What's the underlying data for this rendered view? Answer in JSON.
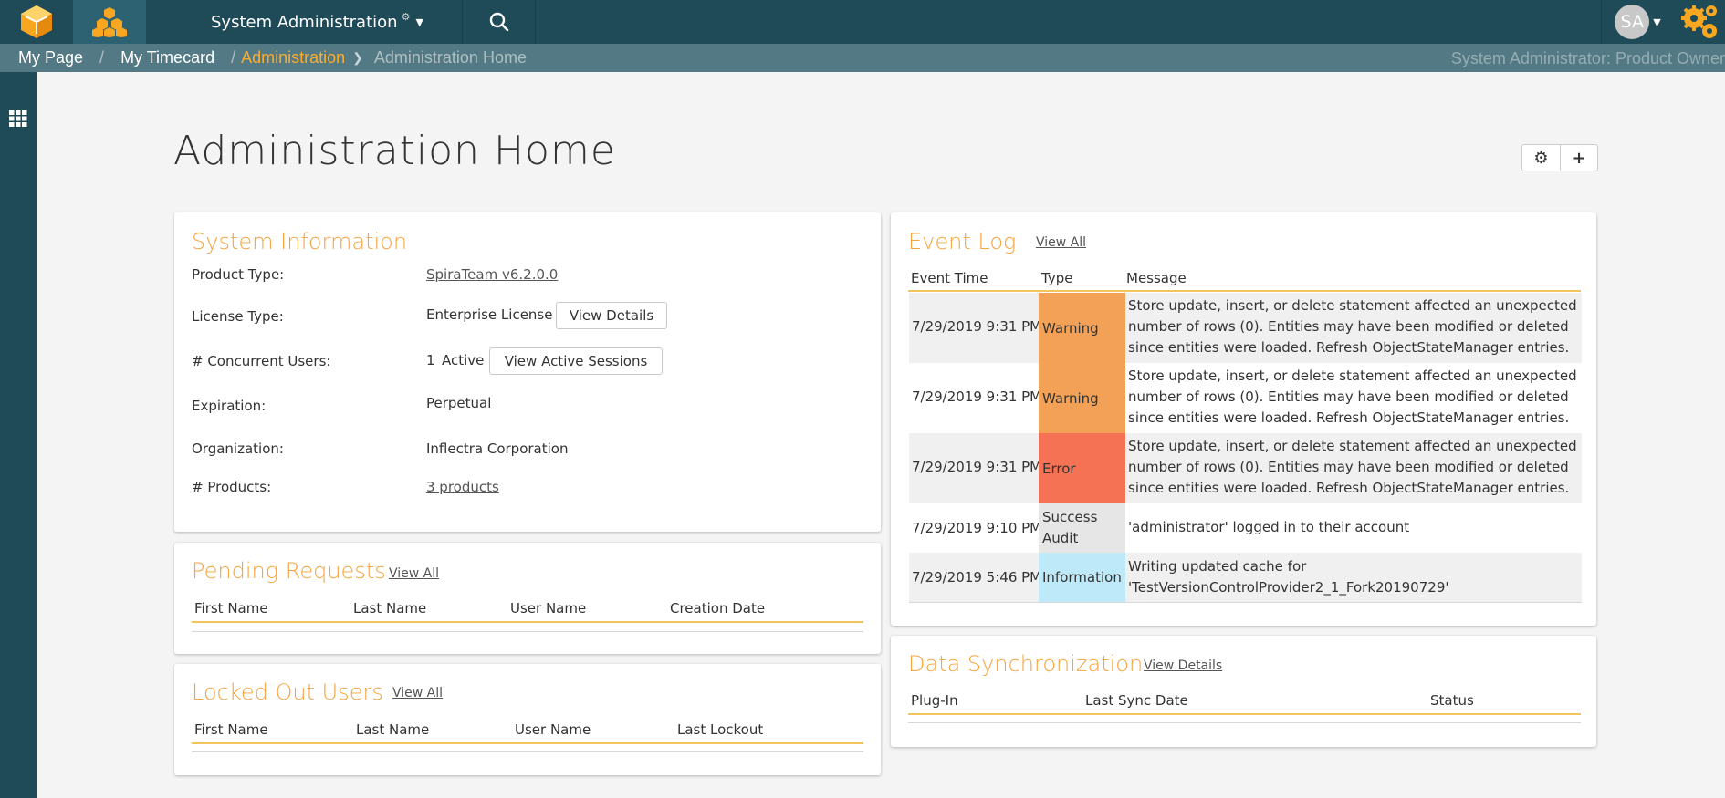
{
  "topbar": {
    "app_menu_label": "System Administration",
    "avatar_initials": "SA",
    "colors": {
      "bar": "#1f4a57",
      "accent": "#f8ad30"
    }
  },
  "breadcrumb": {
    "items": [
      "My Page",
      "My Timecard",
      "Administration",
      "Administration Home"
    ],
    "separator": "/",
    "user_role": "System Administrator: Product Owner"
  },
  "page": {
    "title": "Administration Home"
  },
  "system_information": {
    "title": "System Information",
    "product_type_label": "Product Type:",
    "product_type_value": "SpiraTeam v6.2.0.0",
    "license_type_label": "License Type:",
    "license_type_value": "Enterprise License",
    "license_button": "View Details",
    "concurrent_label": "# Concurrent Users:",
    "concurrent_count": "1",
    "concurrent_status": "Active",
    "sessions_button": "View Active Sessions",
    "expiration_label": "Expiration:",
    "expiration_value": "Perpetual",
    "organization_label": "Organization:",
    "organization_value": "Inflectra Corporation",
    "products_label": "# Products:",
    "products_value": "3 products"
  },
  "pending_requests": {
    "title": "Pending Requests",
    "view_all": "View All",
    "columns": [
      "First Name",
      "Last Name",
      "User Name",
      "Creation Date"
    ]
  },
  "locked_out_users": {
    "title": "Locked Out Users",
    "view_all": "View All",
    "columns": [
      "First Name",
      "Last Name",
      "User Name",
      "Last Lockout"
    ]
  },
  "event_log": {
    "title": "Event Log",
    "view_all": "View All",
    "columns": [
      "Event Time",
      "Type",
      "Message"
    ],
    "rows": [
      {
        "time": "7/29/2019 9:31 PM",
        "type": "Warning",
        "type_color": "#f2a156",
        "message": "Store update, insert, or delete statement affected an unexpected number of rows (0). Entities may have been modified or deleted since entities were loaded. Refresh ObjectStateManager entries."
      },
      {
        "time": "7/29/2019 9:31 PM",
        "type": "Warning",
        "type_color": "#f2a156",
        "message": "Store update, insert, or delete statement affected an unexpected number of rows (0). Entities may have been modified or deleted since entities were loaded. Refresh ObjectStateManager entries."
      },
      {
        "time": "7/29/2019 9:31 PM",
        "type": "Error",
        "type_color": "#f57354",
        "message": "Store update, insert, or delete statement affected an unexpected number of rows (0). Entities may have been modified or deleted since entities were loaded. Refresh ObjectStateManager entries."
      },
      {
        "time": "7/29/2019 9:10 PM",
        "type": "Success Audit",
        "type_color": "#e6e6e6",
        "message": "'administrator' logged in to their account"
      },
      {
        "time": "7/29/2019 5:46 PM",
        "type": "Information",
        "type_color": "#bde9f9",
        "message": "Writing updated cache for 'TestVersionControlProvider2_1_Fork20190729'"
      }
    ]
  },
  "data_sync": {
    "title": "Data Synchronization",
    "view_details": "View Details",
    "columns": [
      "Plug-In",
      "Last Sync Date",
      "Status"
    ]
  }
}
